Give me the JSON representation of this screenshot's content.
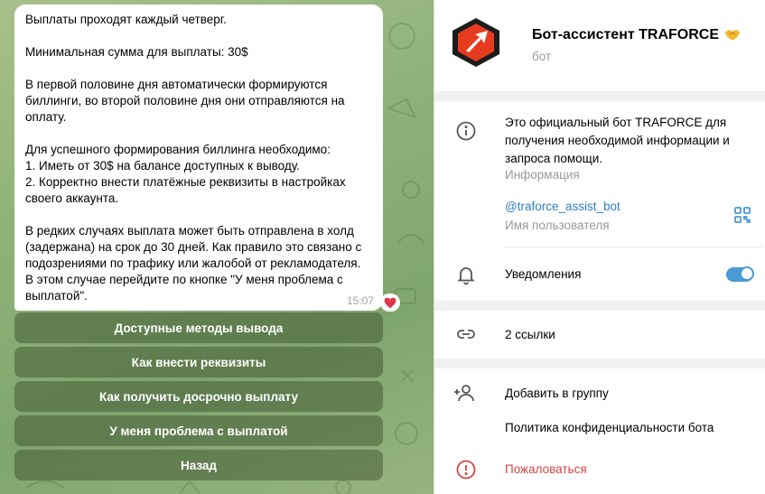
{
  "chat": {
    "message_lines": [
      "Выплаты проходят каждый четверг.",
      "",
      "Минимальная сумма для выплаты: 30$",
      "",
      "В первой половине дня автоматически формируются",
      "биллинги, во второй половине дня они отправляются на",
      "оплату.",
      "",
      "Для успешного формирования биллинга необходимо:",
      "1. Иметь от 30$ на балансе доступных к выводу.",
      "2. Корректно внести платёжные реквизиты в настройках",
      "своего аккаунта.",
      "",
      "В редких случаях выплата может быть отправлена в холд",
      "(задержана) на срок до 30 дней. Как правило это связано с",
      "подозрениями по трафику или жалобой от рекламодателя.",
      "В этом случае перейдите по кнопке \"У меня проблема с",
      "выплатой\"."
    ],
    "time": "15:07",
    "reaction_icon": "heart-icon",
    "buttons": [
      "Доступные методы вывода",
      "Как внести реквизиты",
      "Как получить досрочно выплату",
      "У меня проблема с выплатой",
      "Назад"
    ]
  },
  "profile": {
    "name": "Бот-ассистент TRAFORCE",
    "name_emoji_icon": "handshake-icon",
    "subtitle": "бот",
    "about_text_lines": [
      "Это официальный бот TRAFORCE для",
      "получения необходимой информации и",
      "запроса помощи."
    ],
    "about_label": "Информация",
    "username": "@traforce_assist_bot",
    "username_label": "Имя пользователя",
    "notifications_label": "Уведомления",
    "notifications_on": true,
    "links_label": "2 ссылки",
    "add_to_group": "Добавить в группу",
    "privacy_policy": "Политика конфиденциальности бота",
    "report": "Пожаловаться"
  },
  "colors": {
    "accent": "#4a9ad4",
    "link": "#2f7fbf",
    "danger": "#d14545",
    "muted": "#999999",
    "icon": "#555555",
    "avatar_red": "#e63b1f",
    "avatar_dark": "#1c1c1c"
  }
}
